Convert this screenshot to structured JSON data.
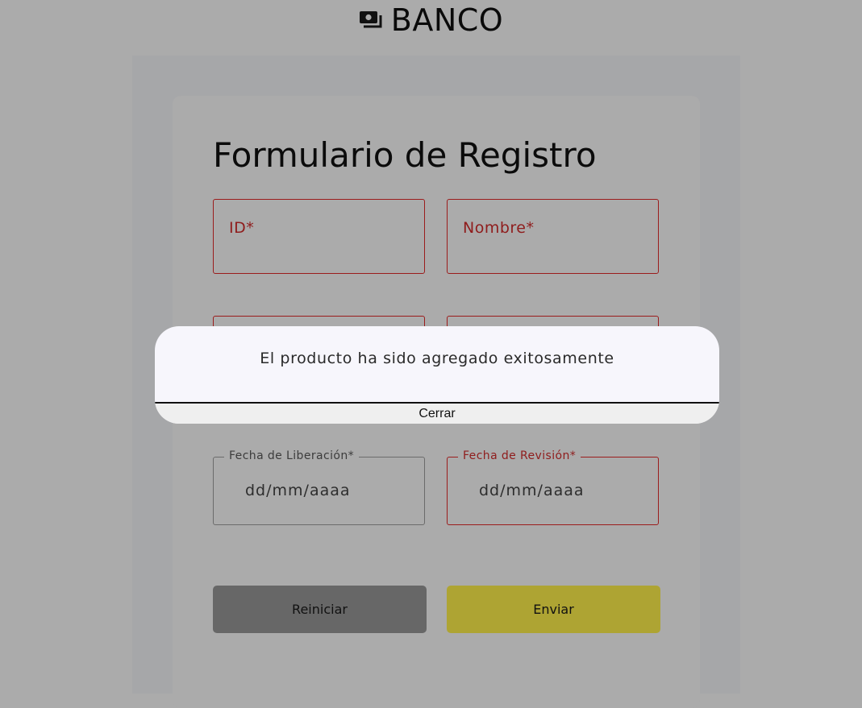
{
  "header": {
    "title": "BANCO",
    "icon": "money-icon"
  },
  "form": {
    "title": "Formulario de Registro",
    "fields": {
      "id": {
        "label": "ID*"
      },
      "name": {
        "label": "Nombre*"
      },
      "release_date": {
        "label": "Fecha de Liberación*",
        "placeholder": "dd/mm/aaaa"
      },
      "revision_date": {
        "label": "Fecha de Revisión*",
        "placeholder": "dd/mm/aaaa"
      }
    },
    "buttons": {
      "reset": "Reiniciar",
      "submit": "Enviar"
    }
  },
  "dialog": {
    "message": "El producto ha sido agregado exitosamente",
    "close_label": "Cerrar"
  },
  "colors": {
    "error": "#9b1c1c",
    "submit": "#aea433",
    "reset": "#676767",
    "backdrop": "#ababab"
  }
}
